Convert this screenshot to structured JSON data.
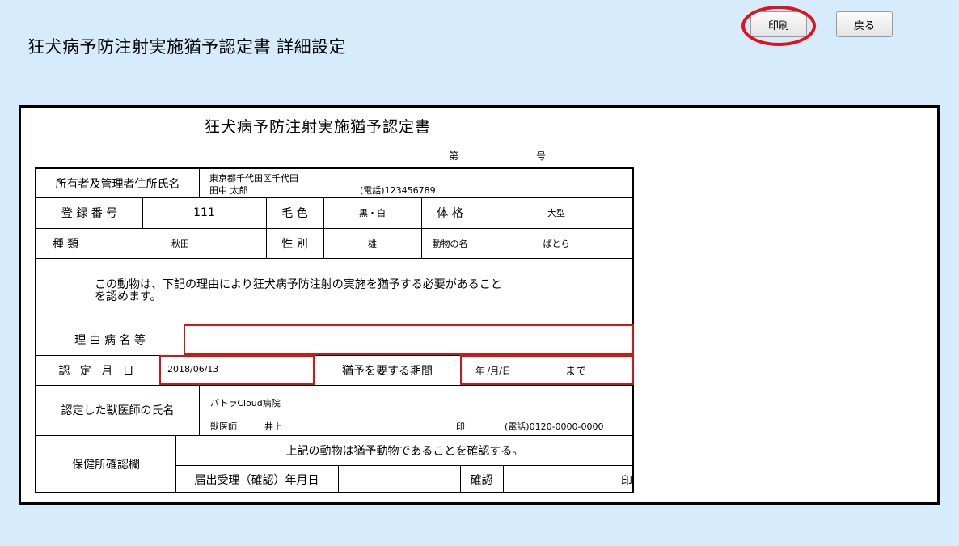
{
  "page": {
    "title": "狂犬病予防注射実施猶予認定書 詳細設定"
  },
  "toolbar": {
    "print_label": "印刷",
    "back_label": "戻る"
  },
  "certificate": {
    "title": "狂犬病予防注射実施猶予認定書",
    "number_prefix": "第",
    "number_suffix": "号",
    "owner_label": "所有者及管理者住所氏名",
    "owner_address": "東京都千代田区千代田",
    "owner_name": "田中 太郎",
    "owner_phone": "(電話)123456789",
    "reg_label": "登 録 番 号",
    "reg_value": "111",
    "coat_label": "毛 色",
    "coat_value": "黒・白",
    "size_label": "体 格",
    "size_value": "大型",
    "breed_label": "種 類",
    "breed_value": "秋田",
    "sex_label": "性 別",
    "sex_value": "雄",
    "animal_name_label": "動物の名",
    "animal_name_value": "ぱとら",
    "statement_line1": "この動物は、下記の理由により狂犬病予防注射の実施を猶予する必要があること",
    "statement_line2": "を認めます。",
    "reason_label": "理 由 病 名 等",
    "reason_value": "",
    "cert_date_label": "認 定 月 日",
    "cert_date_value": "2018/06/13",
    "period_label": "猶予を要する期間",
    "period_value": "年 /月/日",
    "period_until": "まで",
    "vet_label": "認定した獣医師の氏名",
    "clinic_name": "パトラCloud病院",
    "vet_title": "獣医師",
    "vet_name": "井上",
    "vet_seal": "印",
    "vet_phone": "(電話)0120-0000-0000",
    "health_label": "保健所確認欄",
    "health_statement": "上記の動物は猶予動物であることを確認する。",
    "receipt_label": "届出受理（確認）年月日",
    "receipt_value": "",
    "confirm_label": "確認",
    "confirm_seal": "印"
  }
}
